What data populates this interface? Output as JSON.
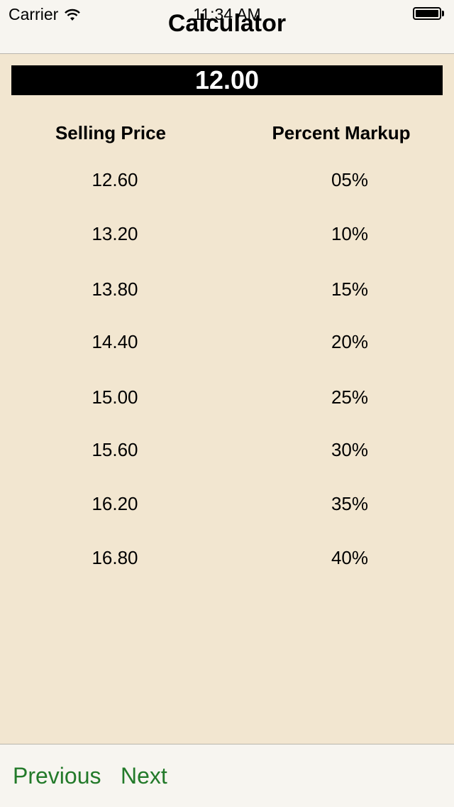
{
  "status_bar": {
    "carrier": "Carrier",
    "time": "11:34 AM",
    "icons": [
      "wifi-icon",
      "battery-icon"
    ]
  },
  "nav": {
    "title": "Calculator"
  },
  "display": {
    "value": "12.00"
  },
  "table": {
    "headers": [
      "Selling Price",
      "Percent Markup"
    ],
    "rows": [
      {
        "price": "12.60",
        "percent": "05%"
      },
      {
        "price": "13.20",
        "percent": "10%"
      },
      {
        "price": "13.80",
        "percent": "15%"
      },
      {
        "price": "14.40",
        "percent": "20%"
      },
      {
        "price": "15.00",
        "percent": "25%"
      },
      {
        "price": "15.60",
        "percent": "30%"
      },
      {
        "price": "16.20",
        "percent": "35%"
      },
      {
        "price": "16.80",
        "percent": "40%"
      }
    ]
  },
  "toolbar": {
    "previous_label": "Previous",
    "next_label": "Next"
  },
  "colors": {
    "background": "#f2e6d0",
    "bar": "#f7f5f0",
    "accent": "#237a2a",
    "display_bg": "#000000",
    "display_text": "#ffffff"
  }
}
